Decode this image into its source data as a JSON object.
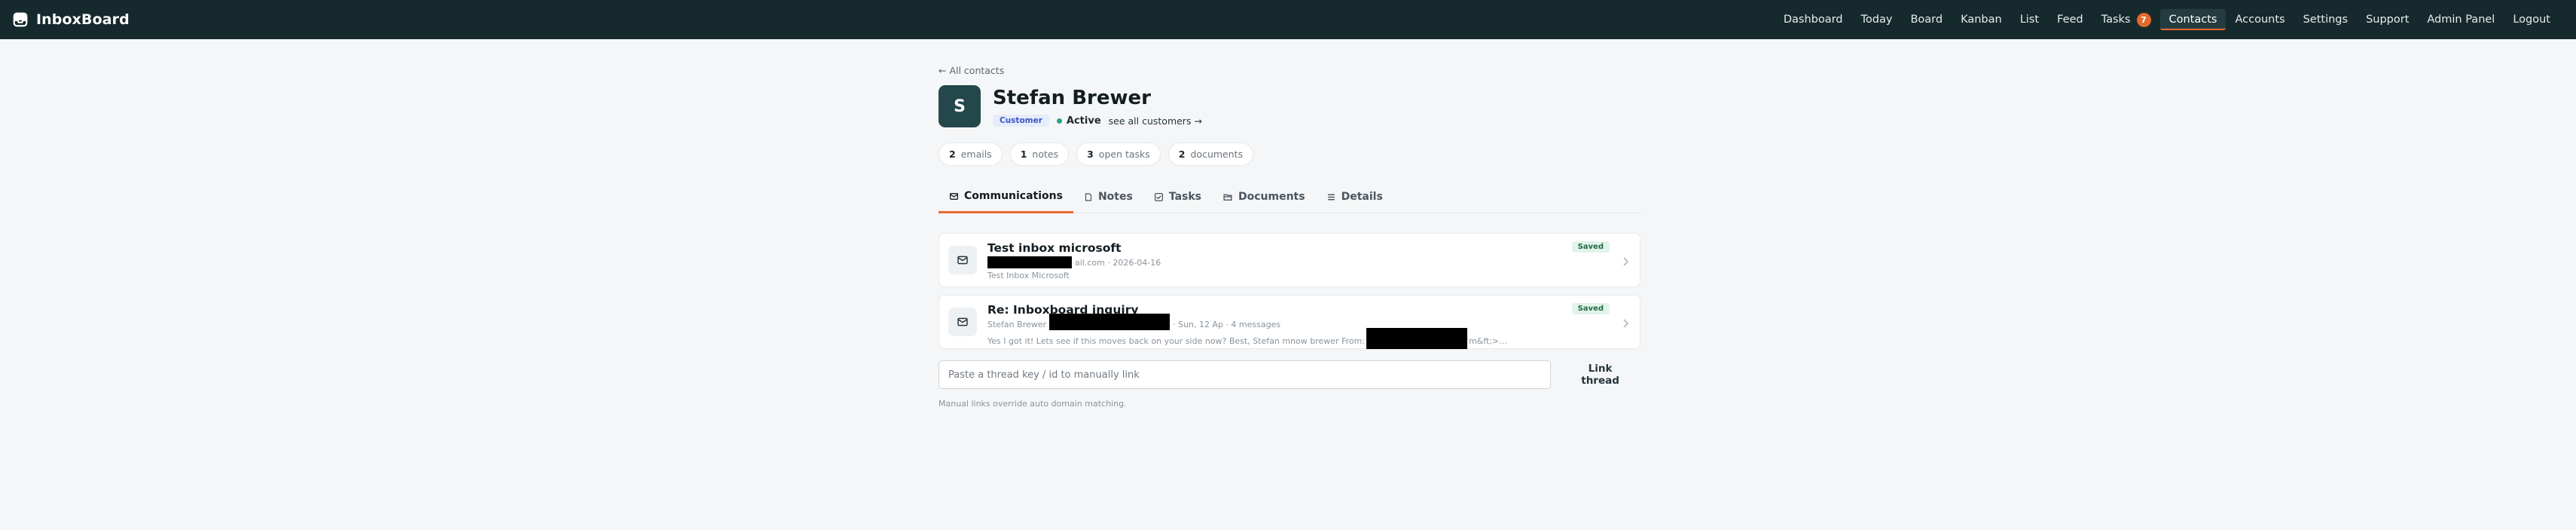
{
  "app": {
    "name": "InboxBoard",
    "logo_icon": "inbox-icon"
  },
  "nav": {
    "items": [
      {
        "label": "Dashboard"
      },
      {
        "label": "Today"
      },
      {
        "label": "Board"
      },
      {
        "label": "Kanban"
      },
      {
        "label": "List"
      },
      {
        "label": "Feed"
      },
      {
        "label": "Tasks",
        "badge": "7"
      },
      {
        "label": "Contacts",
        "active": true
      },
      {
        "label": "Accounts"
      },
      {
        "label": "Settings"
      },
      {
        "label": "Support"
      },
      {
        "label": "Admin Panel"
      },
      {
        "label": "Logout"
      }
    ]
  },
  "contact": {
    "back_label": "← All contacts",
    "initial": "S",
    "name": "Stefan Brewer",
    "type_badge": "Customer",
    "status": "Active",
    "see_all_label": "see all customers →"
  },
  "stats": [
    {
      "count": "2",
      "label": "emails"
    },
    {
      "count": "1",
      "label": "notes"
    },
    {
      "count": "3",
      "label": "open tasks"
    },
    {
      "count": "2",
      "label": "documents"
    }
  ],
  "tabs": [
    {
      "label": "Communications",
      "icon": "mail-icon",
      "active": true
    },
    {
      "label": "Notes",
      "icon": "note-icon"
    },
    {
      "label": "Tasks",
      "icon": "checkbox-icon"
    },
    {
      "label": "Documents",
      "icon": "folder-icon"
    },
    {
      "label": "Details",
      "icon": "list-icon"
    }
  ],
  "threads": [
    {
      "subject": "Test inbox microsoft",
      "meta_suffix": "ail.com · 2026-04-16",
      "preview": "Test Inbox Microsoft",
      "badge": "Saved"
    },
    {
      "subject": "Re: Inboxboard inquiry",
      "meta_prefix": "Stefan Brewer",
      "meta_suffix": "· Sun, 12 Ap · 4 messages",
      "preview_start": "Yes I got it! Lets see if this moves back on your side now? Best, Stefan mnow brewer From:",
      "preview_end": "m&ft;>...",
      "badge": "Saved"
    }
  ],
  "manual_link": {
    "placeholder": "Paste a thread key / id to manually link",
    "button_label": "Link thread",
    "hint": "Manual links override auto domain matching."
  },
  "colors": {
    "topbar": "#16292c",
    "accent": "#e56a2e",
    "avatar": "#24474b",
    "status_active": "#2da37a"
  }
}
